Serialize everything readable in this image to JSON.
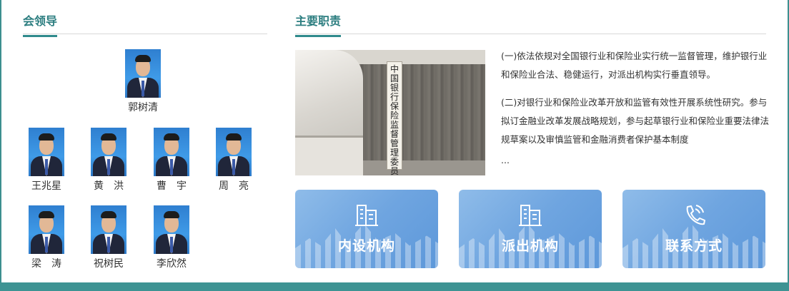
{
  "leaders_section": {
    "title": "会领导",
    "leaders": [
      {
        "name": "郭树清"
      },
      {
        "name": "王兆星"
      },
      {
        "name": "黄　洪"
      },
      {
        "name": "曹　宇"
      },
      {
        "name": "周　亮"
      },
      {
        "name": "梁　涛"
      },
      {
        "name": "祝树民"
      },
      {
        "name": "李欣然"
      }
    ]
  },
  "duties_section": {
    "title": "主要职责",
    "photo_sign_text": "中国银行保险监督管理委员会",
    "paragraphs": [
      "(一)依法依规对全国银行业和保险业实行统一监督管理，维护银行业和保险业合法、稳健运行，对派出机构实行垂直领导。",
      "(二)对银行业和保险业改革开放和监管有效性开展系统性研究。参与拟订金融业改革发展战略规划，参与起草银行业和保险业重要法律法规草案以及审慎监管和金融消费者保护基本制度"
    ],
    "more": "..."
  },
  "cards": [
    {
      "label": "内设机构",
      "icon": "building-icon"
    },
    {
      "label": "派出机构",
      "icon": "building-icon"
    },
    {
      "label": "联系方式",
      "icon": "phone-icon"
    }
  ],
  "colors": {
    "accent": "#2c7e80",
    "bar": "#3e9393",
    "card": "#6fa5e0"
  }
}
